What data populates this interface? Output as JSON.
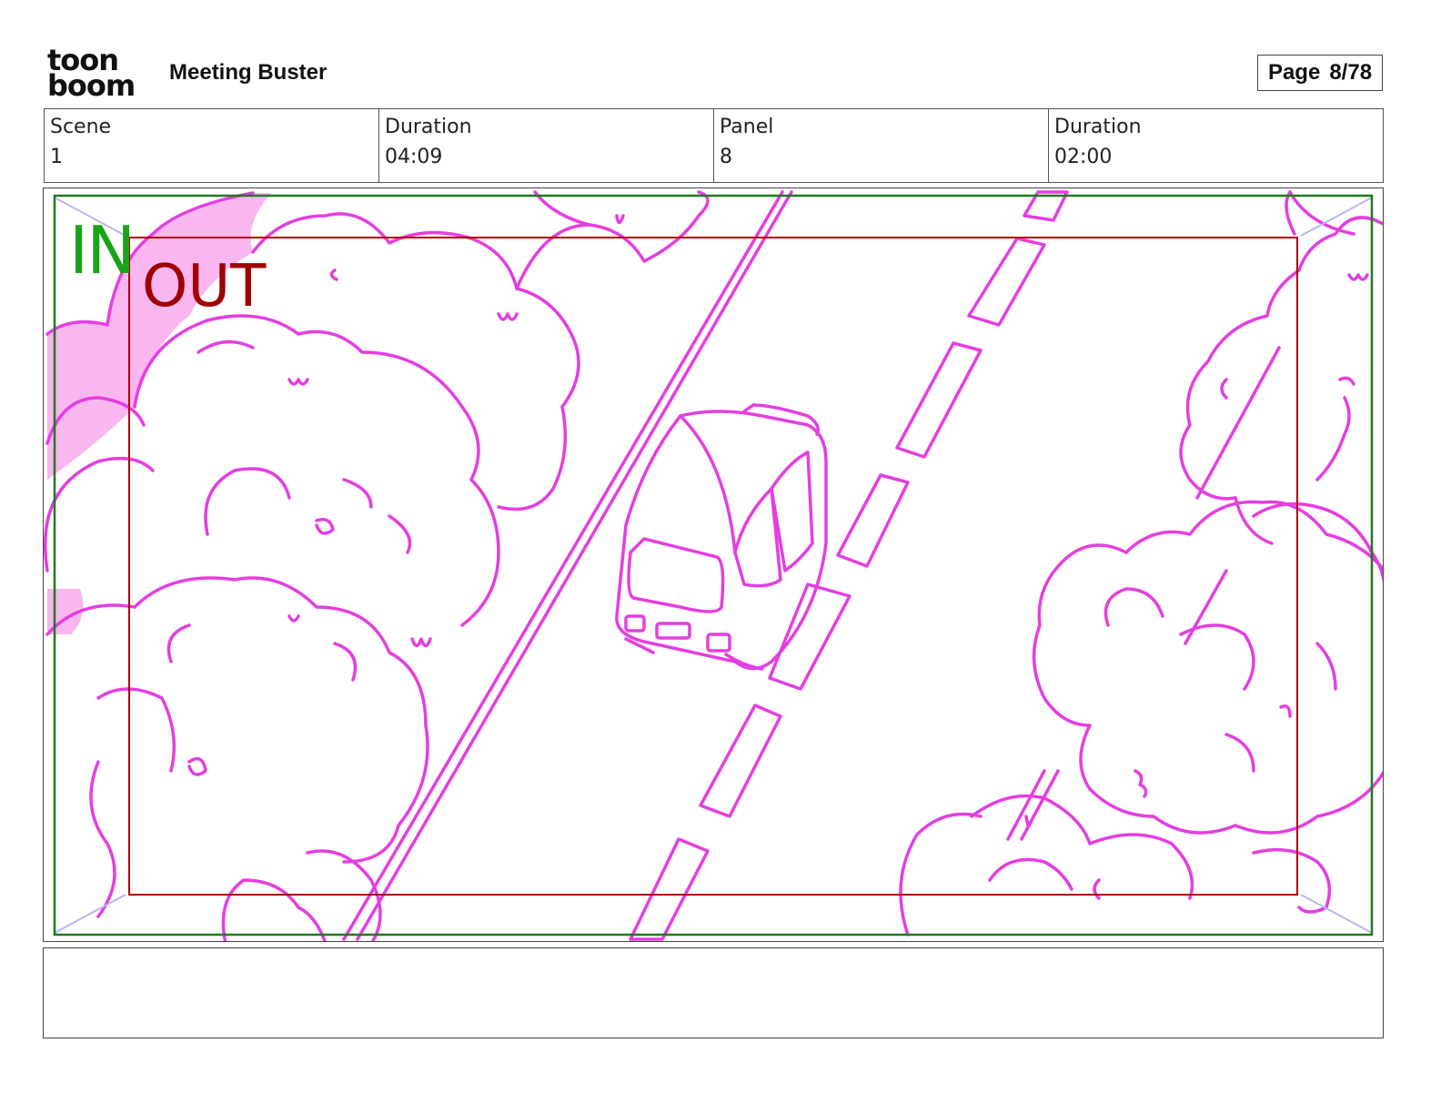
{
  "header": {
    "logo_line1": "toon",
    "logo_line2": "boom",
    "project_title": "Meeting Buster",
    "page_label": "Page",
    "page_value": "8/78"
  },
  "info": {
    "scene_label": "Scene",
    "scene_value": "1",
    "scene_duration_label": "Duration",
    "scene_duration_value": "04:09",
    "panel_label": "Panel",
    "panel_value": "8",
    "panel_duration_label": "Duration",
    "panel_duration_value": "02:00"
  },
  "panel": {
    "in_label": "IN",
    "out_label": "OUT",
    "colors": {
      "sketch": "#e43ee0",
      "in_frame": "#1e7a1e",
      "out_frame": "#b00000",
      "corner_arrows": "#b8b8f0",
      "fill_pink": "#f9b6ef"
    }
  },
  "notes": {
    "text": ""
  }
}
